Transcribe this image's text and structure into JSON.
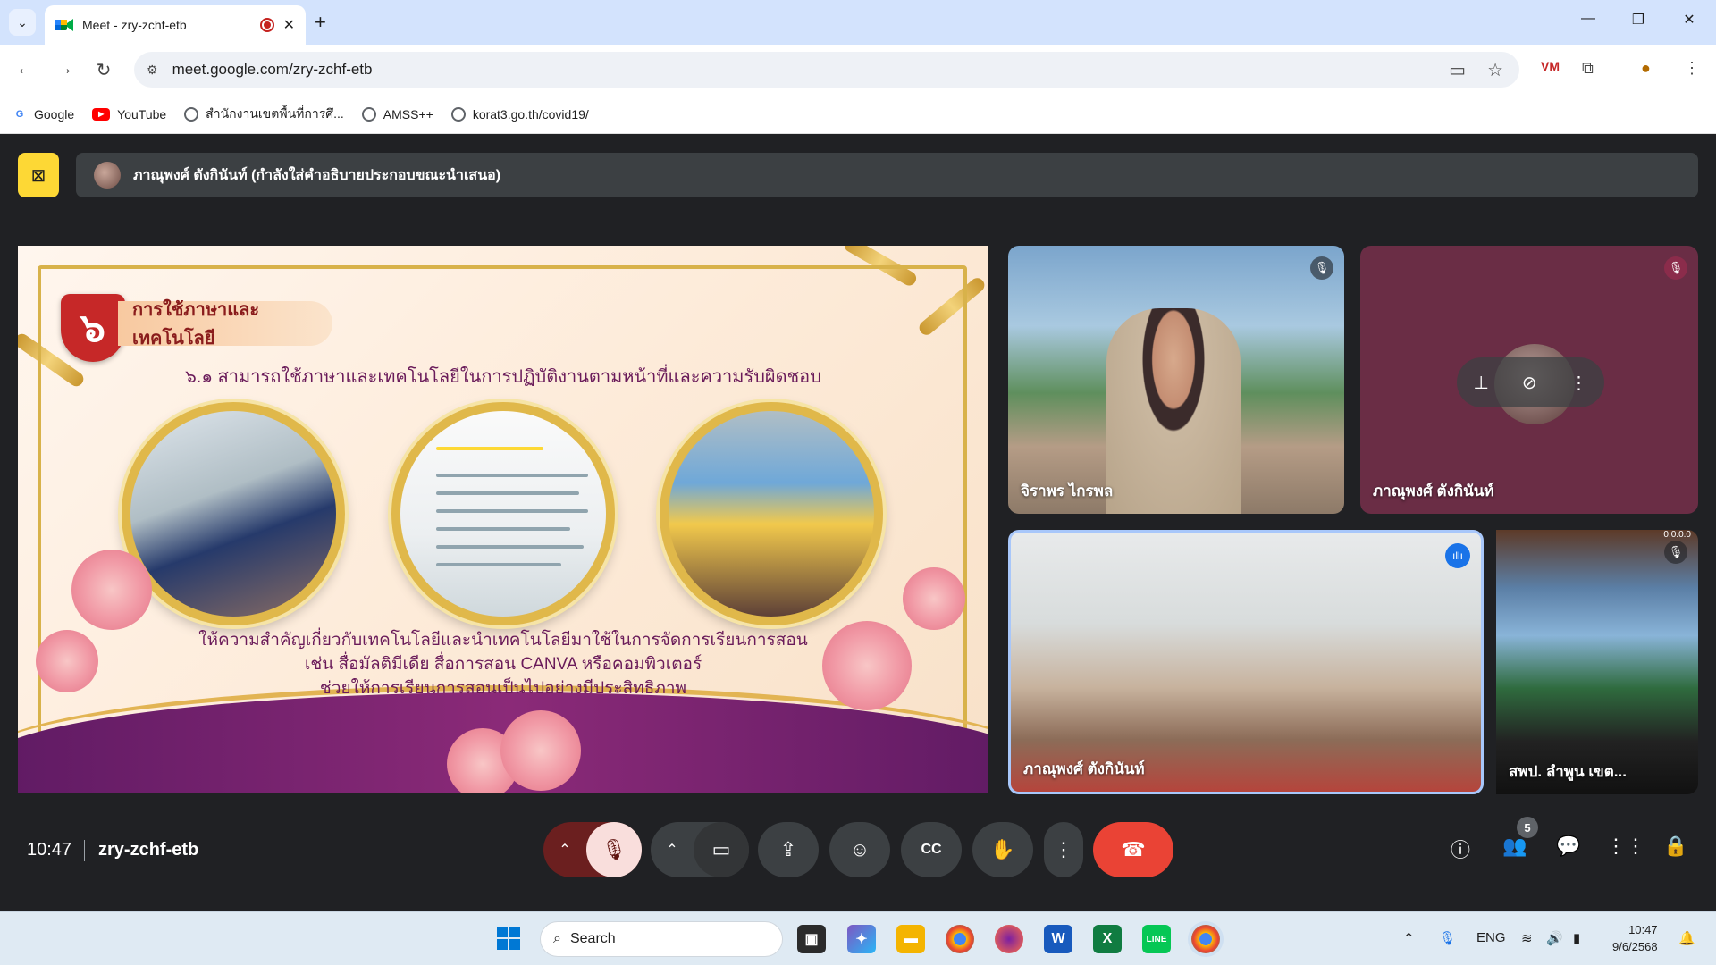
{
  "browser": {
    "tab_title": "Meet - zry-zchf-etb",
    "url": "meet.google.com/zry-zchf-etb",
    "bookmarks": [
      {
        "label": "Google",
        "icon": "google-g-icon",
        "color": "#4285f4"
      },
      {
        "label": "YouTube",
        "icon": "youtube-icon",
        "color": "#ff0000"
      },
      {
        "label": "สำนักงานเขตพื้นที่การศึ...",
        "icon": "globe-icon",
        "color": "#5f6368"
      },
      {
        "label": "AMSS++",
        "icon": "globe-icon",
        "color": "#5f6368"
      },
      {
        "label": "korat3.go.th/covid19/",
        "icon": "globe-icon",
        "color": "#5f6368"
      }
    ]
  },
  "meet": {
    "presenter_banner": "ภาณุพงศ์ ตังกินันท์ (กำลังใส่คำอธิบายประกอบขณะนำเสนอ)",
    "slide": {
      "badge": "๖",
      "topic": "การใช้ภาษาและเทคโนโลยี",
      "subtitle": "๖.๑ สามารถใช้ภาษาและเทคโนโลยีในการปฏิบัติงานตามหน้าที่และความรับผิดชอบ",
      "body_lines": [
        "ให้ความสำคัญเกี่ยวกับเทคโนโลยีและนำเทคโนโลยีมาใช้ในการจัดการเรียนการสอน",
        "เช่น สื่อมัลติมีเดีย สื่อการสอน CANVA หรือคอมพิวเตอร์",
        "ช่วยให้การเรียนการสอนเป็นไปอย่างมีประสิทธิภาพ"
      ]
    },
    "participants": [
      {
        "name": "จิราพร ไกรพล",
        "muted": true
      },
      {
        "name": "ภาณุพงศ์ ตังกินันท์",
        "muted": true
      },
      {
        "name": "ภาณุพงศ์ ตังกินันท์",
        "speaking": true
      },
      {
        "name": "สพป. ลำพูน เขต...",
        "muted": true,
        "tag": "0.0.0.0"
      }
    ],
    "clock": "10:47",
    "meeting_code": "zry-zchf-etb",
    "people_count": "5"
  },
  "taskbar": {
    "search_placeholder": "Search",
    "language": "ENG",
    "time": "10:47",
    "date": "9/6/2568"
  },
  "colors": {
    "meet_bg": "#202124",
    "leave_red": "#ea4335",
    "mic_muted_bg": "#f9dedc",
    "presenter_yellow": "#fdd835",
    "tab_strip": "#d3e3fd"
  }
}
